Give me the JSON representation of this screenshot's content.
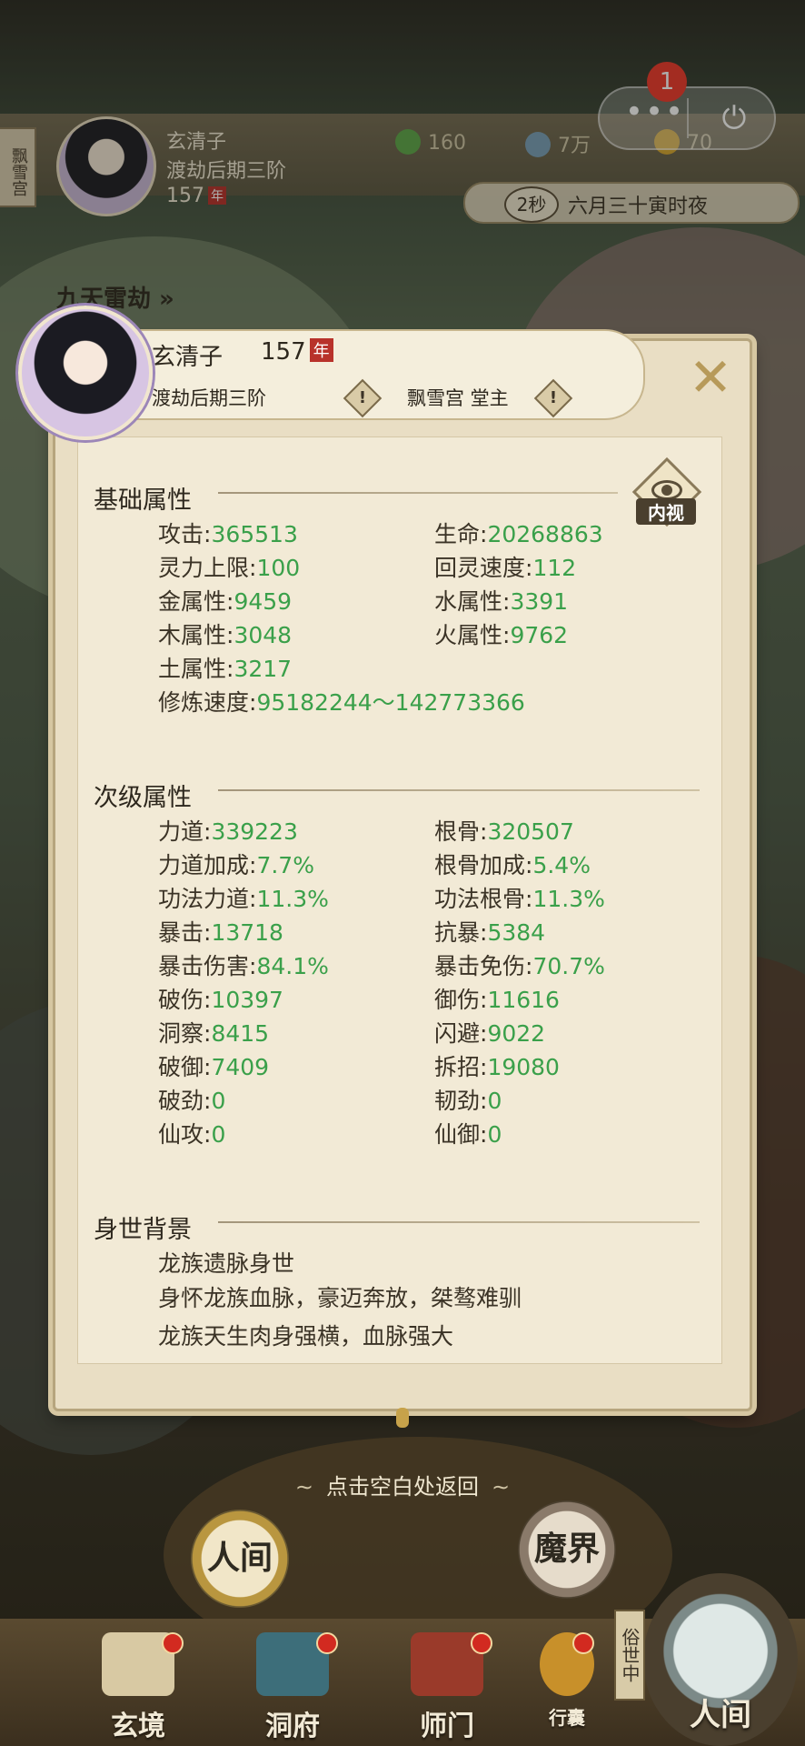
{
  "status_capsule": {
    "badge_count": "1",
    "more_symbol": "•••",
    "power_symbol": "⏻"
  },
  "topbar": {
    "sect_tag": "飘雪宫",
    "name": "玄清子",
    "realm": "渡劫后期三阶",
    "age": "157",
    "nian": "年",
    "resources": [
      {
        "icon": "leaf-icon",
        "value": "160",
        "color": "#5fa84a"
      },
      {
        "icon": "coin-icon",
        "value": "7万",
        "color": "#7aa0b8"
      },
      {
        "icon": "gold-icon",
        "value": "70",
        "color": "#d8a830"
      }
    ],
    "time_seconds": "2秒",
    "time_text": "六月三十寅时夜",
    "thunder_link": "九天雷劫 »"
  },
  "dialog": {
    "name": "玄清子",
    "age": "157",
    "nian": "年",
    "realm": "渡劫后期三阶",
    "sect_role": "飘雪宫 堂主",
    "info_symbol": "!",
    "close_symbol": "✕",
    "inspect_label": "内视",
    "basic": {
      "title": "基础属性",
      "rows": [
        {
          "left_label": "攻击:",
          "left_value": "365513",
          "right_label": "生命:",
          "right_value": "20268863"
        },
        {
          "left_label": "灵力上限:",
          "left_value": "100",
          "right_label": "回灵速度:",
          "right_value": "112"
        },
        {
          "left_label": "金属性:",
          "left_value": "9459",
          "right_label": "水属性:",
          "right_value": "3391"
        },
        {
          "left_label": "木属性:",
          "left_value": "3048",
          "right_label": "火属性:",
          "right_value": "9762"
        },
        {
          "left_label": "土属性:",
          "left_value": "3217"
        },
        {
          "left_label": "修炼速度:",
          "left_value": "95182244～142773366"
        }
      ]
    },
    "secondary": {
      "title": "次级属性",
      "rows": [
        {
          "left_label": "力道:",
          "left_value": "339223",
          "right_label": "根骨:",
          "right_value": "320507"
        },
        {
          "left_label": "力道加成:",
          "left_value": "7.7%",
          "right_label": "根骨加成:",
          "right_value": "5.4%"
        },
        {
          "left_label": "功法力道:",
          "left_value": "11.3%",
          "right_label": "功法根骨:",
          "right_value": "11.3%"
        },
        {
          "left_label": "暴击:",
          "left_value": "13718",
          "right_label": "抗暴:",
          "right_value": "5384"
        },
        {
          "left_label": "暴击伤害:",
          "left_value": "84.1%",
          "right_label": "暴击免伤:",
          "right_value": "70.7%"
        },
        {
          "left_label": "破伤:",
          "left_value": "10397",
          "right_label": "御伤:",
          "right_value": "11616"
        },
        {
          "left_label": "洞察:",
          "left_value": "8415",
          "right_label": "闪避:",
          "right_value": "9022"
        },
        {
          "left_label": "破御:",
          "left_value": "7409",
          "right_label": "拆招:",
          "right_value": "19080"
        },
        {
          "left_label": "破劲:",
          "left_value": "0",
          "right_label": "韧劲:",
          "right_value": "0"
        },
        {
          "left_label": "仙攻:",
          "left_value": "0",
          "right_label": "仙御:",
          "right_value": "0"
        }
      ]
    },
    "background": {
      "title": "身世背景",
      "lines": [
        "龙族遗脉身世",
        "身怀龙族血脉，豪迈奔放，桀骜难驯",
        "龙族天生肉身强横，血脉强大"
      ]
    }
  },
  "return_hint": "点击空白处返回",
  "world_buttons": {
    "human": "人间",
    "demon": "魔界"
  },
  "nav": [
    {
      "label": "玄境",
      "icon": "scroll-icon"
    },
    {
      "label": "洞府",
      "icon": "pavilion-icon"
    },
    {
      "label": "师门",
      "icon": "banner-icon"
    },
    {
      "label": "行囊",
      "icon": "bag-icon"
    }
  ],
  "world_tag": "俗世中",
  "world_label": "人间",
  "colors": {
    "attr_value": "#3aa04a",
    "accent_red": "#b8322b",
    "panel": "#f2ead6"
  }
}
